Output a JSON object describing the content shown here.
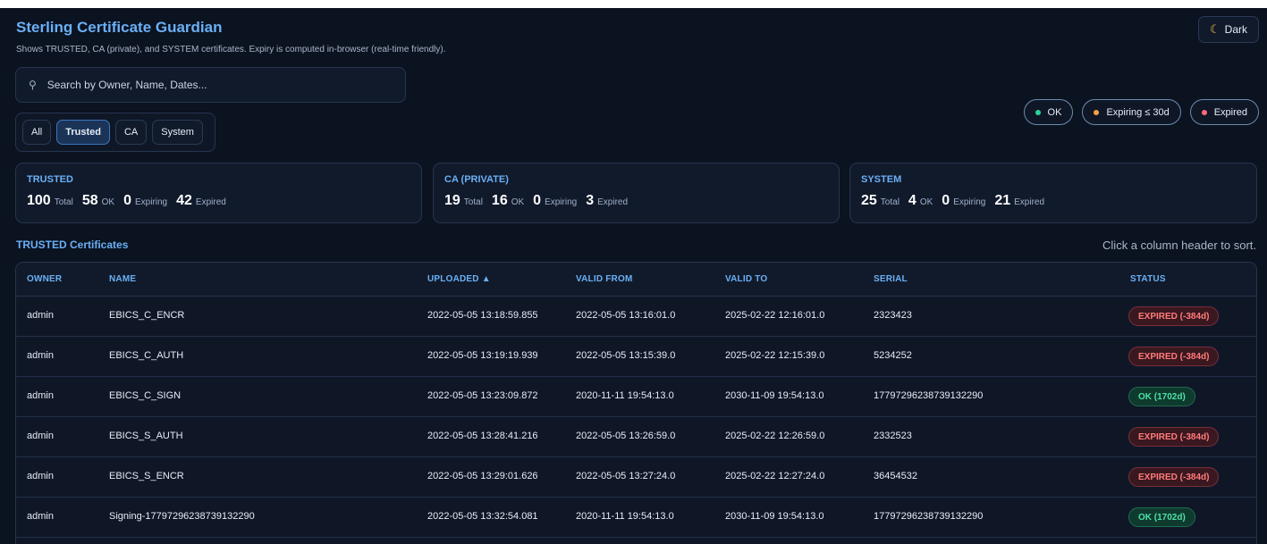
{
  "app": {
    "title": "Sterling Certificate Guardian",
    "subtitle": "Shows TRUSTED, CA (private), and SYSTEM certificates. Expiry is computed in-browser (real-time friendly).",
    "theme_label": "Dark"
  },
  "search": {
    "placeholder": "Search by Owner, Name, Dates..."
  },
  "filters": [
    "All",
    "Trusted",
    "CA",
    "System"
  ],
  "legend": {
    "ok": {
      "label": "OK",
      "color": "#2bd39a"
    },
    "expiring": {
      "label": "Expiring ≤ 30d",
      "color": "#f5a142"
    },
    "expired": {
      "label": "Expired",
      "color": "#ff6b78"
    }
  },
  "cards": [
    {
      "title": "TRUSTED",
      "total": "100",
      "ok": "58",
      "expiring": "0",
      "expired": "42"
    },
    {
      "title": "CA (PRIVATE)",
      "total": "19",
      "ok": "16",
      "expiring": "0",
      "expired": "3"
    },
    {
      "title": "SYSTEM",
      "total": "25",
      "ok": "4",
      "expiring": "0",
      "expired": "21"
    }
  ],
  "stat_labels": {
    "total": "Total",
    "ok": "OK",
    "expiring": "Expiring",
    "expired": "Expired"
  },
  "section": {
    "title": "TRUSTED Certificates",
    "hint": "Click a column header to sort."
  },
  "table": {
    "headers": {
      "owner": "OWNER",
      "name": "NAME",
      "uploaded": "UPLOADED ▲",
      "valid_from": "VALID FROM",
      "valid_to": "VALID TO",
      "serial": "SERIAL",
      "status": "STATUS"
    },
    "rows": [
      {
        "owner": "admin",
        "name": "EBICS_C_ENCR",
        "uploaded": "2022-05-05 13:18:59.855",
        "valid_from": "2022-05-05 13:16:01.0",
        "valid_to": "2025-02-22 12:16:01.0",
        "serial": "2323423",
        "status": "EXPIRED (-384d)"
      },
      {
        "owner": "admin",
        "name": "EBICS_C_AUTH",
        "uploaded": "2022-05-05 13:19:19.939",
        "valid_from": "2022-05-05 13:15:39.0",
        "valid_to": "2025-02-22 12:15:39.0",
        "serial": "5234252",
        "status": "EXPIRED (-384d)"
      },
      {
        "owner": "admin",
        "name": "EBICS_C_SIGN",
        "uploaded": "2022-05-05 13:23:09.872",
        "valid_from": "2020-11-11 19:54:13.0",
        "valid_to": "2030-11-09 19:54:13.0",
        "serial": "17797296238739132290",
        "status": "OK (1702d)"
      },
      {
        "owner": "admin",
        "name": "EBICS_S_AUTH",
        "uploaded": "2022-05-05 13:28:41.216",
        "valid_from": "2022-05-05 13:26:59.0",
        "valid_to": "2025-02-22 12:26:59.0",
        "serial": "2332523",
        "status": "EXPIRED (-384d)"
      },
      {
        "owner": "admin",
        "name": "EBICS_S_ENCR",
        "uploaded": "2022-05-05 13:29:01.626",
        "valid_from": "2022-05-05 13:27:24.0",
        "valid_to": "2025-02-22 12:27:24.0",
        "serial": "36454532",
        "status": "EXPIRED (-384d)"
      },
      {
        "owner": "admin",
        "name": "Signing-17797296238739132290",
        "uploaded": "2022-05-05 13:32:54.081",
        "valid_from": "2020-11-11 19:54:13.0",
        "valid_to": "2030-11-09 19:54:13.0",
        "serial": "17797296238739132290",
        "status": "OK (1702d)"
      }
    ]
  }
}
